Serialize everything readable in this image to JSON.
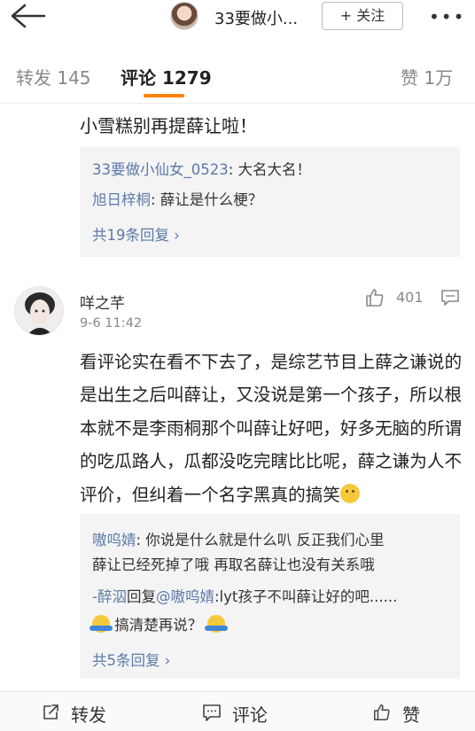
{
  "header": {
    "title": "33要做小...",
    "follow_label": "+ 关注",
    "more_label": "•••"
  },
  "tabs": [
    {
      "label": "转发",
      "count": "145"
    },
    {
      "label": "评论",
      "count": "1279"
    },
    {
      "label": "赞",
      "count": "1万"
    }
  ],
  "comment1": {
    "text": "小雪糕别再提薛让啦！",
    "replies": [
      {
        "user": "33要做小仙女_0523",
        "text": ": 大名大名！"
      },
      {
        "user": "旭日梓桐",
        "text": ": 薛让是什么梗？"
      }
    ],
    "more_replies": "共19条回复 ›"
  },
  "comment2": {
    "user": "咩之芊",
    "time": "9-6 11:42",
    "likes": "401",
    "text": "看评论实在看不下去了，是综艺节目上薛之谦说的是出生之后叫薛让，又没说是第一个孩子，所以根本就不是李雨桐那个叫薛让好吧，好多无脑的所谓的吃瓜路人，瓜都没吃完瞎比比呢，薛之谦为人不评价，但纠着一个名字黑真的搞笑",
    "replies": {
      "r1_user": "嗷呜婧",
      "r1_text_a": ": 你说是什么就是什么叭 反正我们心里",
      "r1_text_b": "薛让已经死掉了哦 再取名薛让也没有关系哦",
      "r2_user_a": "-醉泅",
      "r2_mid": "回复",
      "r2_user_b": "@嗷呜婧",
      "r2_text": ":lyt孩子不叫薛让好的吧......",
      "r2_tail": "搞清楚再说？"
    },
    "more_replies": "共5条回复 ›"
  },
  "bottom": {
    "repost": "转发",
    "comment": "评论",
    "like": "赞"
  },
  "colors": {
    "accent": "#ff8200",
    "link": "#5d7aa8",
    "reply_bg": "#f4f4f4"
  }
}
